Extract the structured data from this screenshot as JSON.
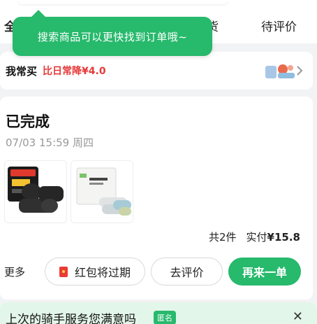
{
  "tabs": {
    "all": "全",
    "cut_tab": "货",
    "to_review": "待评价"
  },
  "tooltip": {
    "text": "搜索商品可以更快找到订单哦~"
  },
  "frequent": {
    "title": "我常买",
    "promo": "比日常降¥4.0",
    "thumb_icon": "product-thumbnail-icon",
    "chevron_icon": "chevron-right-icon"
  },
  "order": {
    "status": "已完成",
    "time": "07/03 15:59 周四",
    "products": [
      {
        "icon": "trash-bag-product-image"
      },
      {
        "icon": "trash-bag-product-image"
      }
    ],
    "count_text": "共2件",
    "paid_label": "实付",
    "amount": "¥15.8",
    "more_label": "更多",
    "actions": {
      "redpacket": "红包将过期",
      "review": "去评价",
      "rebuy": "再来一单"
    }
  },
  "rider": {
    "question": "上次的骑手服务您满意吗",
    "badge": "匿名",
    "close": "✕"
  },
  "colors": {
    "accent": "#27b96c",
    "promo": "#e63a3a",
    "banner": "#e3f6ea"
  }
}
